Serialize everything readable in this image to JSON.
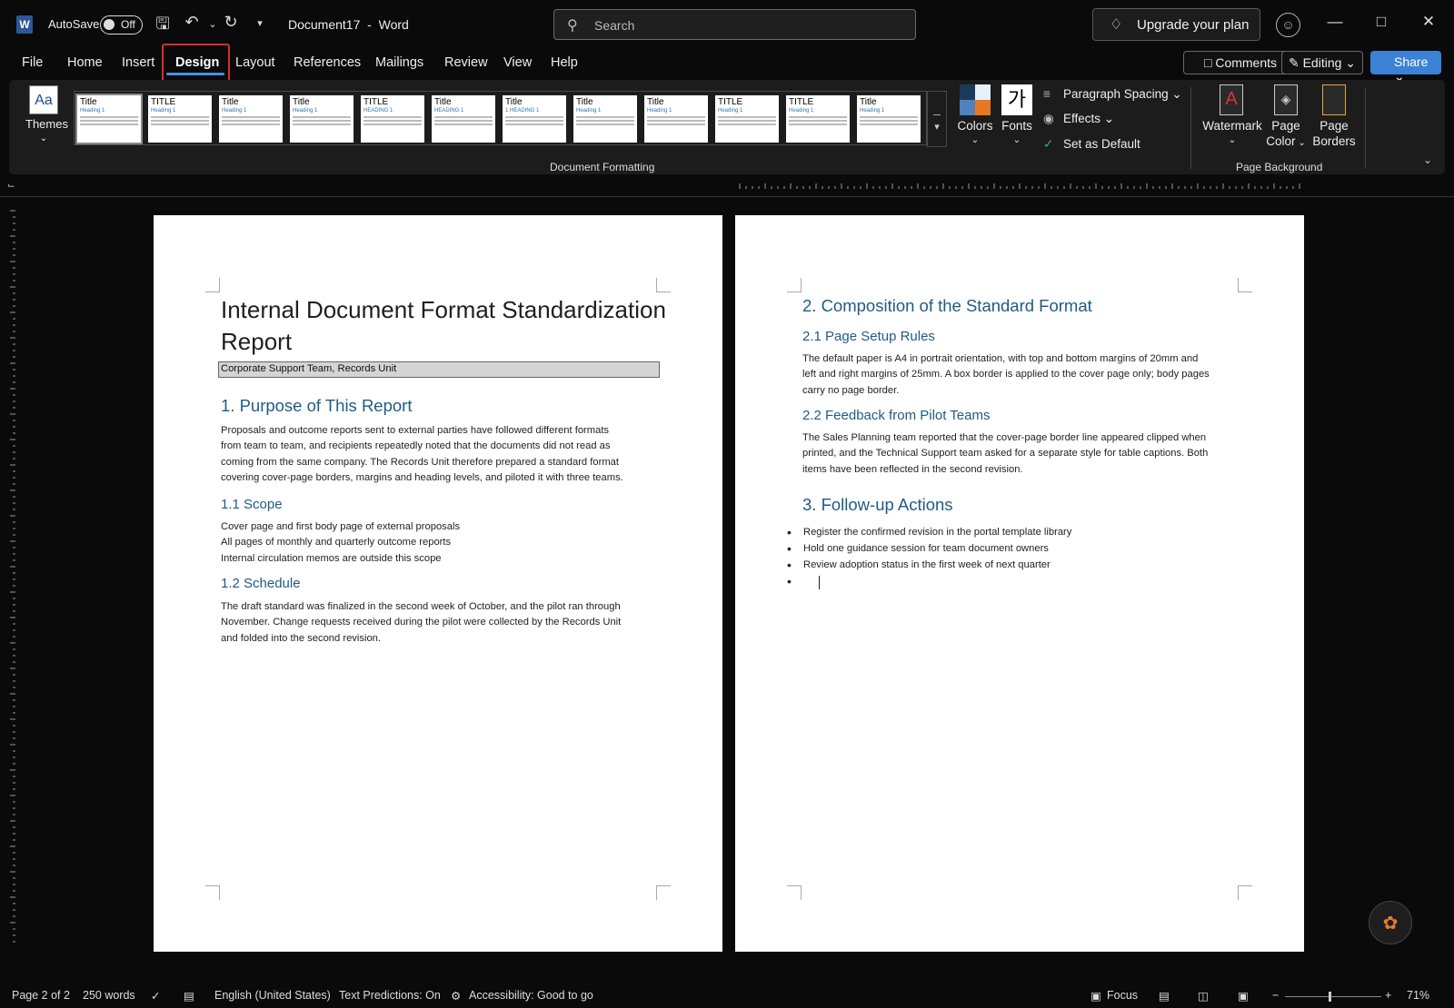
{
  "titlebar": {
    "app_icon": "W",
    "autosave_label": "AutoSave",
    "autosave_state": "Off",
    "doc_title": "Document17",
    "app_name": "Word",
    "search_placeholder": "Search",
    "upgrade_label": "Upgrade your plan",
    "icons": {
      "save": "save-icon",
      "undo": "undo-icon",
      "redo": "redo-icon",
      "customize": "customize-qat-icon"
    }
  },
  "menu": {
    "tabs": [
      "File",
      "Home",
      "Insert",
      "Design",
      "Layout",
      "References",
      "Mailings",
      "Review",
      "View",
      "Help"
    ],
    "active": "Design",
    "comments": "Comments",
    "editing": "Editing",
    "share": "Share"
  },
  "ribbon": {
    "themes": "Themes",
    "gallery_styles": [
      {
        "t": "Title",
        "h": "Heading 1"
      },
      {
        "t": "TITLE",
        "h": "Heading 1"
      },
      {
        "t": "Title",
        "h": "Heading 1"
      },
      {
        "t": "Title",
        "h": "Heading 1"
      },
      {
        "t": "TITLE",
        "h": "HEADING 1"
      },
      {
        "t": "Title",
        "h": "HEADING 1"
      },
      {
        "t": "Title",
        "h": "1 HEADING 1"
      },
      {
        "t": "Title",
        "h": "Heading 1"
      },
      {
        "t": "Title",
        "h": "Heading 1"
      },
      {
        "t": "TITLE",
        "h": "Heading 1"
      },
      {
        "t": "TITLE",
        "h": "Heading 1"
      },
      {
        "t": "Title",
        "h": "Heading 1"
      }
    ],
    "colors": "Colors",
    "fonts": "Fonts",
    "fonts_glyph": "가",
    "paragraph_spacing": "Paragraph Spacing",
    "effects": "Effects",
    "set_default": "Set as Default",
    "document_formatting": "Document Formatting",
    "watermark": "Watermark",
    "page_color_1": "Page",
    "page_color_2": "Color",
    "page_borders_1": "Page",
    "page_borders_2": "Borders",
    "page_background": "Page Background",
    "accent_colors": [
      "#1a3a5c",
      "#e87722",
      "#d0d0d0",
      "#4f81bd"
    ]
  },
  "page1": {
    "title_line1": "Internal Document Format Standardization",
    "title_line2": "Report",
    "subtitle": "Corporate Support Team, Records Unit",
    "h1": "1. Purpose of This Report",
    "p1": [
      "Proposals and outcome reports sent to external parties have followed different formats",
      "from team to team, and recipients repeatedly noted that the documents did not read as",
      "coming from the same company. The Records Unit therefore prepared a standard format",
      "covering cover-page borders, margins and heading levels, and piloted it with three teams."
    ],
    "h1_1": "1.1 Scope",
    "scope": [
      "Cover page and first body page of external proposals",
      "All pages of monthly and quarterly outcome reports",
      "Internal circulation memos are outside this scope"
    ],
    "h1_2": "1.2 Schedule",
    "p2": [
      "The draft standard was finalized in the second week of October, and the pilot ran through",
      "November. Change requests received during the pilot were collected by the Records Unit",
      "and folded into the second revision."
    ]
  },
  "page2": {
    "h2": "2. Composition of the Standard Format",
    "h2_1": "2.1 Page Setup Rules",
    "p3": [
      "The default paper is A4 in portrait orientation, with top and bottom margins of 20mm and",
      "left and right margins of 25mm. A box border is applied to the cover page only; body pages",
      "carry no page border."
    ],
    "h2_2": "2.2 Feedback from Pilot Teams",
    "p4": [
      "The Sales Planning team reported that the cover-page border line appeared clipped when",
      "printed, and the Technical Support team asked for a separate style for table captions. Both",
      "items have been reflected in the second revision."
    ],
    "h3": "3. Follow-up Actions",
    "bullets": [
      "Register the confirmed revision in the portal template library",
      "Hold one guidance session for team document owners",
      "Review adoption status in the first week of next quarter",
      ""
    ]
  },
  "status": {
    "page": "Page 2 of 2",
    "words": "250 words",
    "language": "English (United States)",
    "predictions": "Text Predictions: On",
    "accessibility": "Accessibility: Good to go",
    "focus": "Focus",
    "zoom": "71%"
  }
}
